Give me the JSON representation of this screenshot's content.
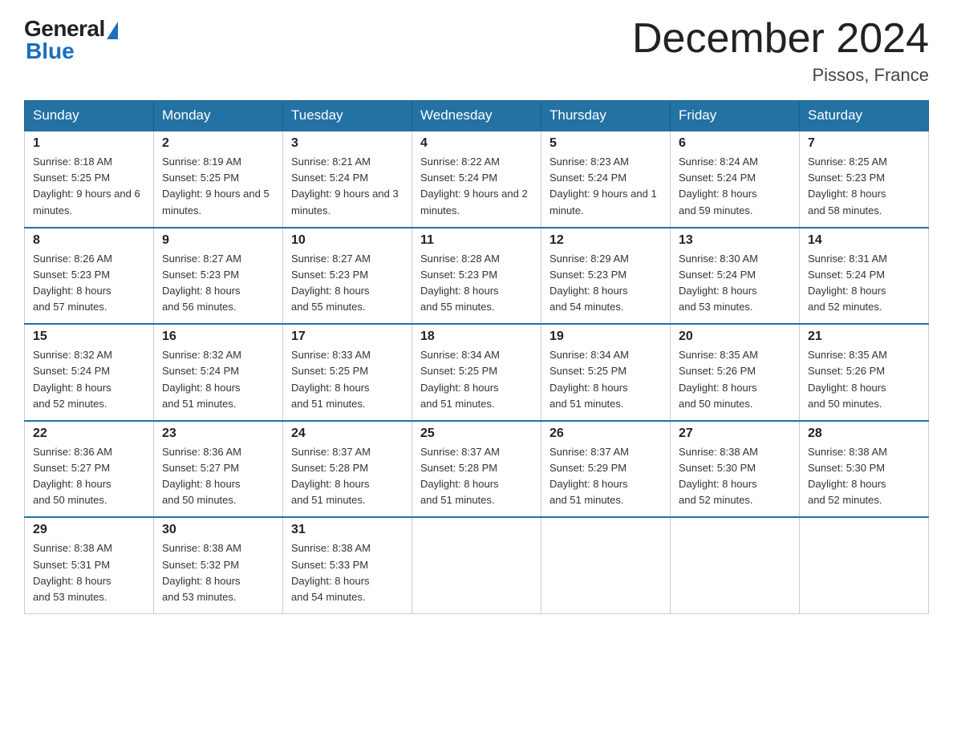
{
  "header": {
    "logo_general": "General",
    "logo_blue": "Blue",
    "title": "December 2024",
    "location": "Pissos, France"
  },
  "days_of_week": [
    "Sunday",
    "Monday",
    "Tuesday",
    "Wednesday",
    "Thursday",
    "Friday",
    "Saturday"
  ],
  "weeks": [
    [
      {
        "num": "1",
        "sunrise": "8:18 AM",
        "sunset": "5:25 PM",
        "daylight": "9 hours and 6 minutes."
      },
      {
        "num": "2",
        "sunrise": "8:19 AM",
        "sunset": "5:25 PM",
        "daylight": "9 hours and 5 minutes."
      },
      {
        "num": "3",
        "sunrise": "8:21 AM",
        "sunset": "5:24 PM",
        "daylight": "9 hours and 3 minutes."
      },
      {
        "num": "4",
        "sunrise": "8:22 AM",
        "sunset": "5:24 PM",
        "daylight": "9 hours and 2 minutes."
      },
      {
        "num": "5",
        "sunrise": "8:23 AM",
        "sunset": "5:24 PM",
        "daylight": "9 hours and 1 minute."
      },
      {
        "num": "6",
        "sunrise": "8:24 AM",
        "sunset": "5:24 PM",
        "daylight": "8 hours and 59 minutes."
      },
      {
        "num": "7",
        "sunrise": "8:25 AM",
        "sunset": "5:23 PM",
        "daylight": "8 hours and 58 minutes."
      }
    ],
    [
      {
        "num": "8",
        "sunrise": "8:26 AM",
        "sunset": "5:23 PM",
        "daylight": "8 hours and 57 minutes."
      },
      {
        "num": "9",
        "sunrise": "8:27 AM",
        "sunset": "5:23 PM",
        "daylight": "8 hours and 56 minutes."
      },
      {
        "num": "10",
        "sunrise": "8:27 AM",
        "sunset": "5:23 PM",
        "daylight": "8 hours and 55 minutes."
      },
      {
        "num": "11",
        "sunrise": "8:28 AM",
        "sunset": "5:23 PM",
        "daylight": "8 hours and 55 minutes."
      },
      {
        "num": "12",
        "sunrise": "8:29 AM",
        "sunset": "5:23 PM",
        "daylight": "8 hours and 54 minutes."
      },
      {
        "num": "13",
        "sunrise": "8:30 AM",
        "sunset": "5:24 PM",
        "daylight": "8 hours and 53 minutes."
      },
      {
        "num": "14",
        "sunrise": "8:31 AM",
        "sunset": "5:24 PM",
        "daylight": "8 hours and 52 minutes."
      }
    ],
    [
      {
        "num": "15",
        "sunrise": "8:32 AM",
        "sunset": "5:24 PM",
        "daylight": "8 hours and 52 minutes."
      },
      {
        "num": "16",
        "sunrise": "8:32 AM",
        "sunset": "5:24 PM",
        "daylight": "8 hours and 51 minutes."
      },
      {
        "num": "17",
        "sunrise": "8:33 AM",
        "sunset": "5:25 PM",
        "daylight": "8 hours and 51 minutes."
      },
      {
        "num": "18",
        "sunrise": "8:34 AM",
        "sunset": "5:25 PM",
        "daylight": "8 hours and 51 minutes."
      },
      {
        "num": "19",
        "sunrise": "8:34 AM",
        "sunset": "5:25 PM",
        "daylight": "8 hours and 51 minutes."
      },
      {
        "num": "20",
        "sunrise": "8:35 AM",
        "sunset": "5:26 PM",
        "daylight": "8 hours and 50 minutes."
      },
      {
        "num": "21",
        "sunrise": "8:35 AM",
        "sunset": "5:26 PM",
        "daylight": "8 hours and 50 minutes."
      }
    ],
    [
      {
        "num": "22",
        "sunrise": "8:36 AM",
        "sunset": "5:27 PM",
        "daylight": "8 hours and 50 minutes."
      },
      {
        "num": "23",
        "sunrise": "8:36 AM",
        "sunset": "5:27 PM",
        "daylight": "8 hours and 50 minutes."
      },
      {
        "num": "24",
        "sunrise": "8:37 AM",
        "sunset": "5:28 PM",
        "daylight": "8 hours and 51 minutes."
      },
      {
        "num": "25",
        "sunrise": "8:37 AM",
        "sunset": "5:28 PM",
        "daylight": "8 hours and 51 minutes."
      },
      {
        "num": "26",
        "sunrise": "8:37 AM",
        "sunset": "5:29 PM",
        "daylight": "8 hours and 51 minutes."
      },
      {
        "num": "27",
        "sunrise": "8:38 AM",
        "sunset": "5:30 PM",
        "daylight": "8 hours and 52 minutes."
      },
      {
        "num": "28",
        "sunrise": "8:38 AM",
        "sunset": "5:30 PM",
        "daylight": "8 hours and 52 minutes."
      }
    ],
    [
      {
        "num": "29",
        "sunrise": "8:38 AM",
        "sunset": "5:31 PM",
        "daylight": "8 hours and 53 minutes."
      },
      {
        "num": "30",
        "sunrise": "8:38 AM",
        "sunset": "5:32 PM",
        "daylight": "8 hours and 53 minutes."
      },
      {
        "num": "31",
        "sunrise": "8:38 AM",
        "sunset": "5:33 PM",
        "daylight": "8 hours and 54 minutes."
      },
      null,
      null,
      null,
      null
    ]
  ],
  "labels": {
    "sunrise": "Sunrise:",
    "sunset": "Sunset:",
    "daylight": "Daylight:"
  }
}
